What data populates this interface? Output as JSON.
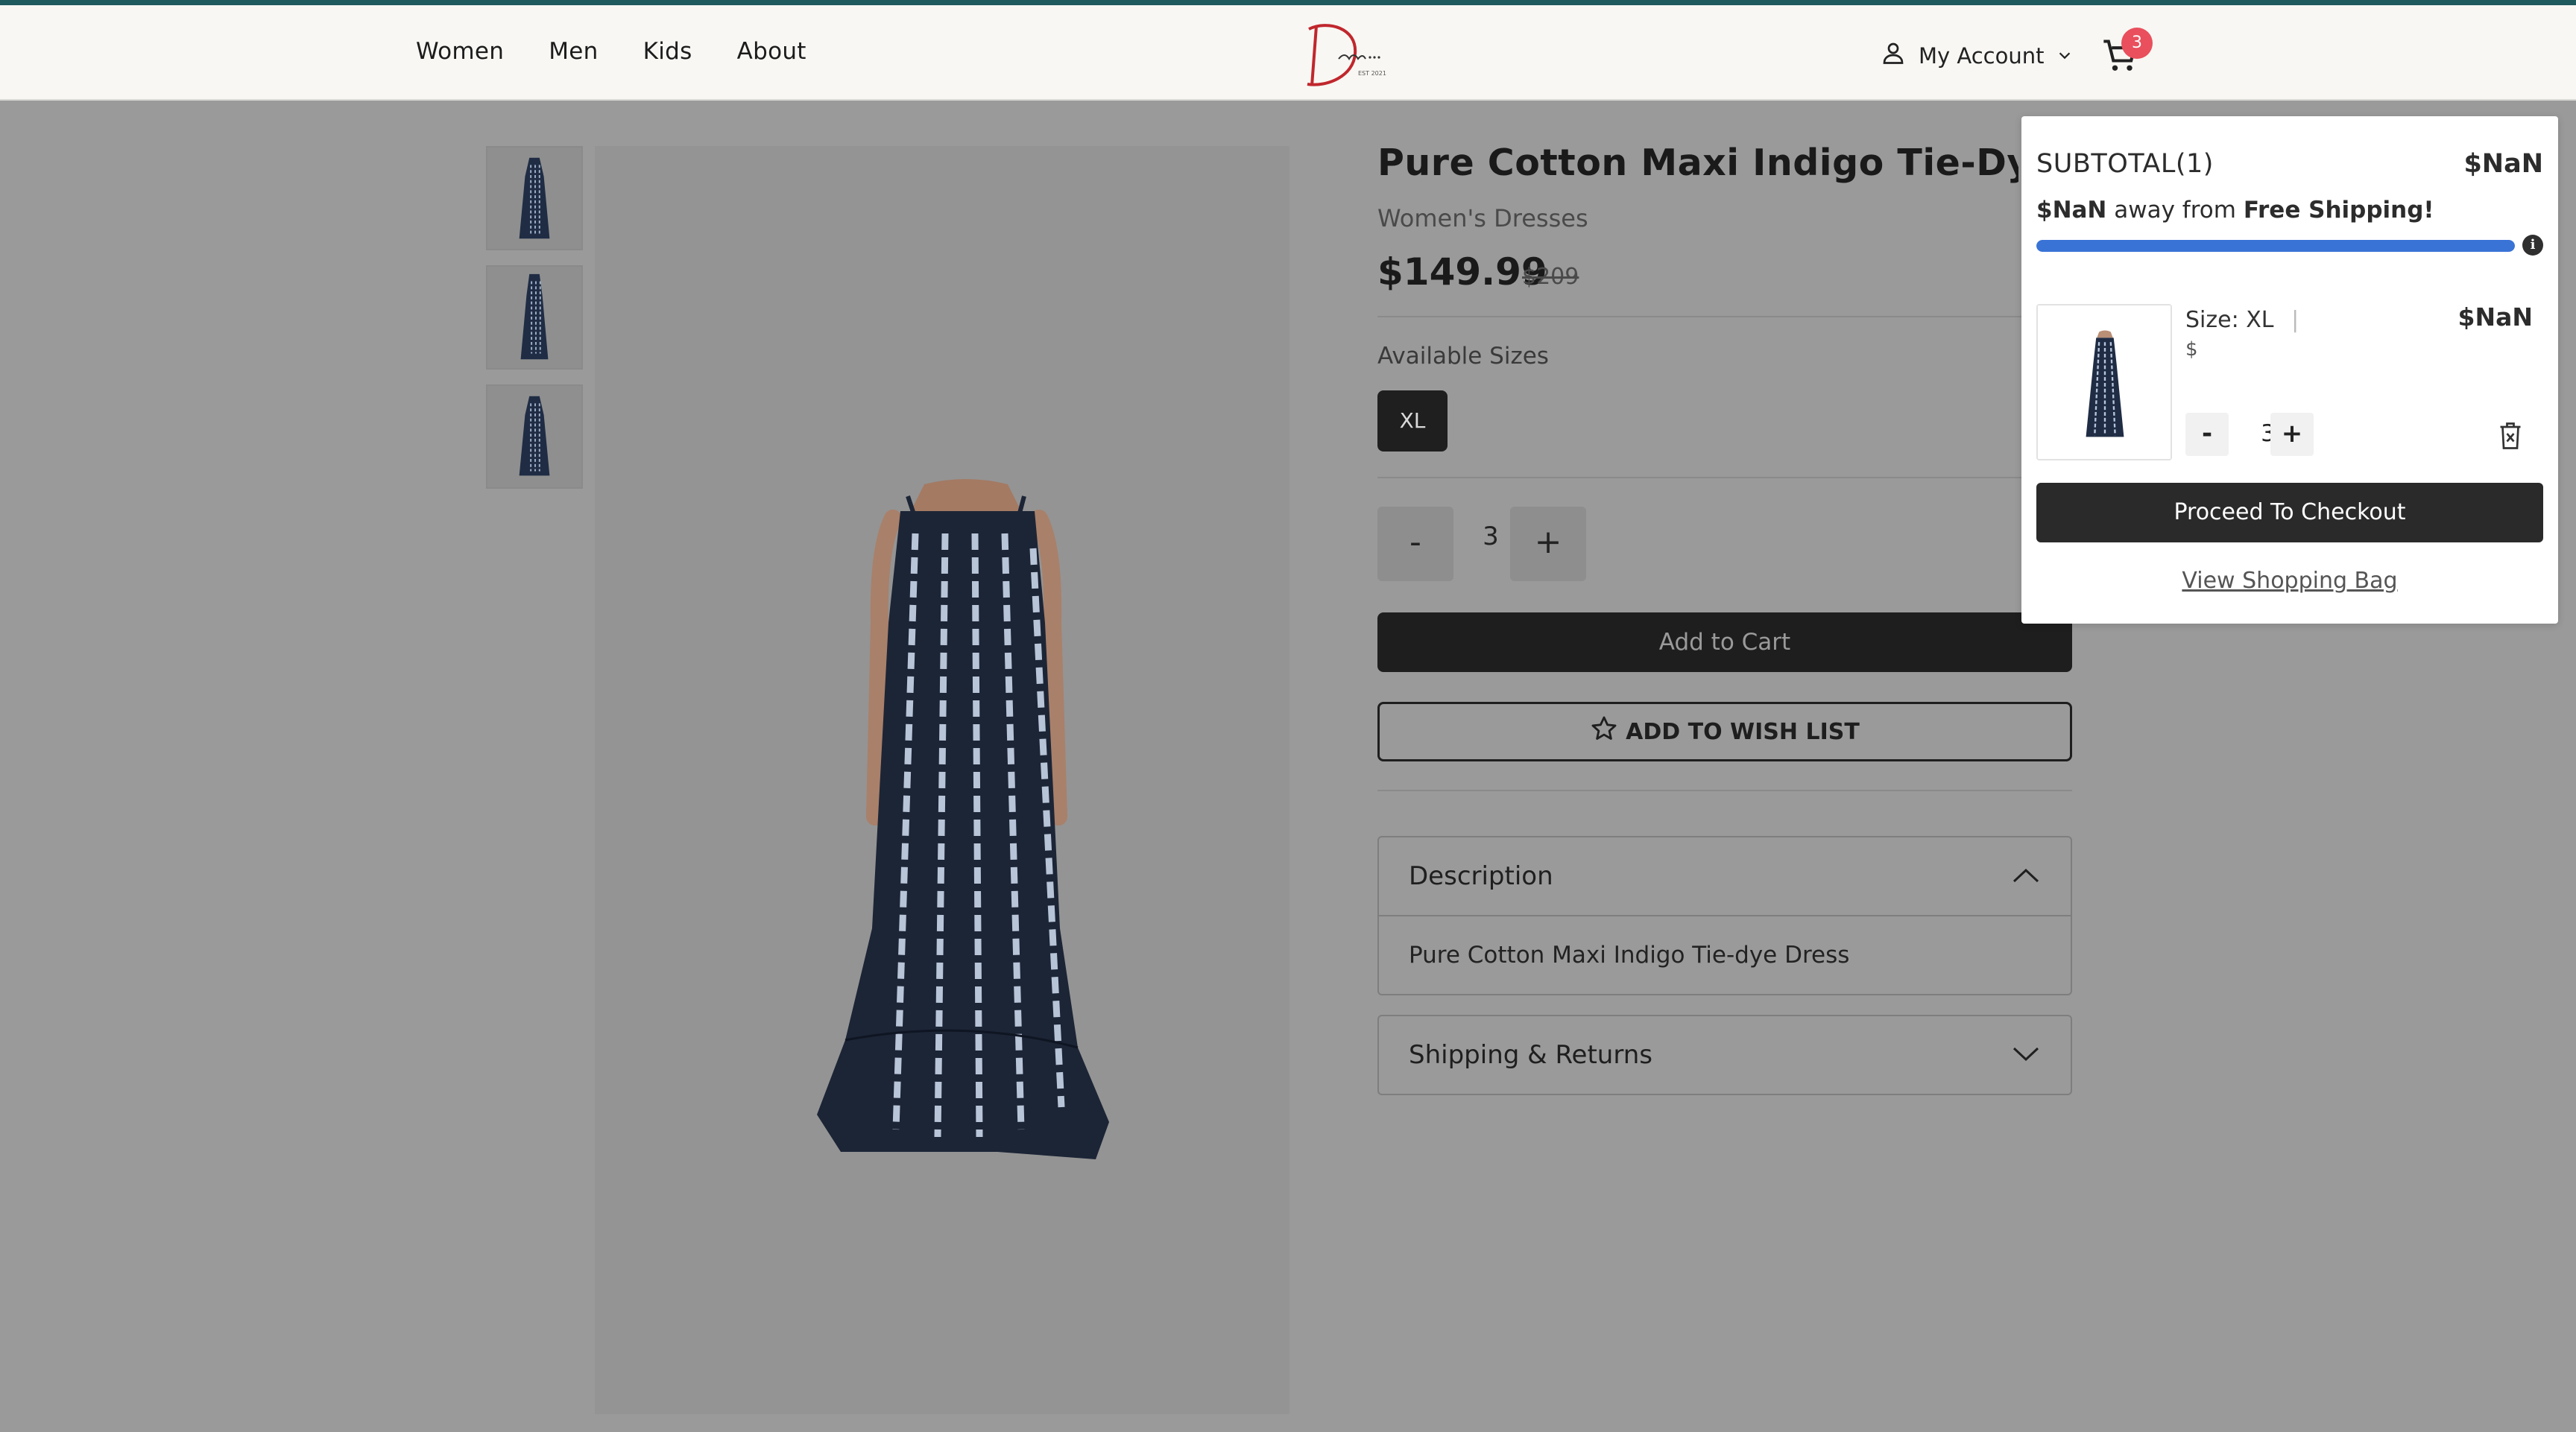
{
  "header": {
    "nav": [
      "Women",
      "Men",
      "Kids",
      "About"
    ],
    "logo_text": "Dee",
    "logo_sub": "EST 2021",
    "account_label": "My Account",
    "cart_count": "3"
  },
  "product": {
    "title": "Pure Cotton Maxi Indigo Tie-Dye Dress",
    "category": "Women's Dresses",
    "price": "$149.99",
    "old_price": "$209",
    "sizes_label": "Available Sizes",
    "sizes": [
      "XL"
    ],
    "quantity": "3",
    "minus": "-",
    "plus": "+",
    "add_to_cart": "Add to Cart",
    "wish_list": "ADD TO WISH LIST",
    "accordions": [
      {
        "title": "Description",
        "body": "Pure Cotton Maxi Indigo Tie-dye Dress",
        "expanded": true
      },
      {
        "title": "Shipping & Returns",
        "expanded": false
      }
    ]
  },
  "mini_cart": {
    "subtotal_label": "SUBTOTAL(1)",
    "subtotal_value": "$NaN",
    "shipping_amount": "$NaN",
    "shipping_middle": "away from",
    "shipping_bold": "Free Shipping!",
    "shipping_progress_percent": 100,
    "item": {
      "size_label": "Size:",
      "size_value": "XL",
      "currency": "$",
      "price": "$NaN",
      "quantity": "3",
      "minus": "-",
      "plus": "+"
    },
    "checkout_label": "Proceed To Checkout",
    "view_bag_label": "View Shopping Bag"
  },
  "colors": {
    "accent_bar": "#1f5a5e",
    "badge": "#e94f5c",
    "progress": "#3a73d6",
    "overlay": "#9a9a9a"
  }
}
